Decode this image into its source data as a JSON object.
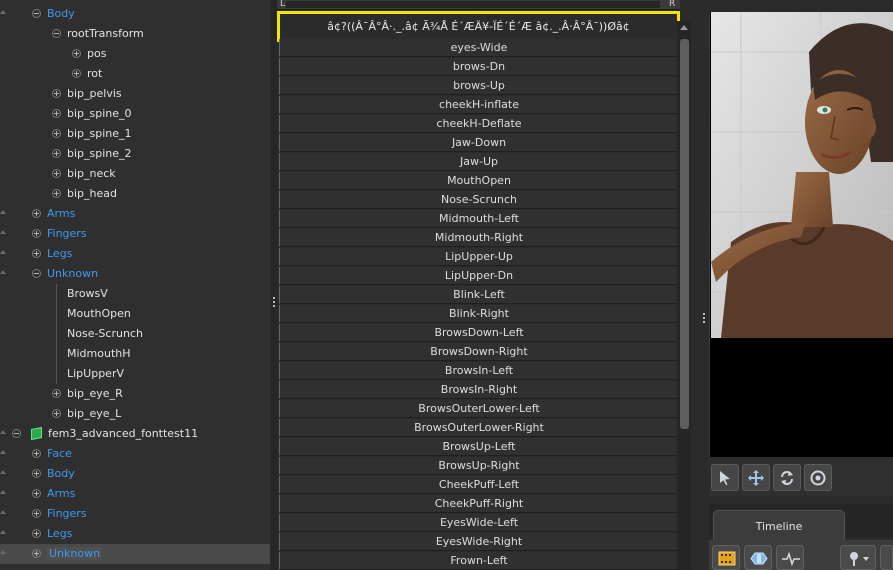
{
  "hierarchy": {
    "items": [
      {
        "label": "Body",
        "depth": 1,
        "toggle": "minus",
        "color": "blue"
      },
      {
        "label": "rootTransform",
        "depth": 2,
        "toggle": "minus",
        "color": "white"
      },
      {
        "label": "pos",
        "depth": 3,
        "toggle": "plus",
        "color": "white"
      },
      {
        "label": "rot",
        "depth": 3,
        "toggle": "plus",
        "color": "white"
      },
      {
        "label": "bip_pelvis",
        "depth": 2,
        "toggle": "plus",
        "color": "white"
      },
      {
        "label": "bip_spine_0",
        "depth": 2,
        "toggle": "plus",
        "color": "white"
      },
      {
        "label": "bip_spine_1",
        "depth": 2,
        "toggle": "plus",
        "color": "white"
      },
      {
        "label": "bip_spine_2",
        "depth": 2,
        "toggle": "plus",
        "color": "white"
      },
      {
        "label": "bip_neck",
        "depth": 2,
        "toggle": "plus",
        "color": "white"
      },
      {
        "label": "bip_head",
        "depth": 2,
        "toggle": "plus",
        "color": "white"
      },
      {
        "label": "Arms",
        "depth": 1,
        "toggle": "plus",
        "color": "blue"
      },
      {
        "label": "Fingers",
        "depth": 1,
        "toggle": "plus",
        "color": "blue"
      },
      {
        "label": "Legs",
        "depth": 1,
        "toggle": "plus",
        "color": "blue"
      },
      {
        "label": "Unknown",
        "depth": 1,
        "toggle": "minus",
        "color": "blue"
      },
      {
        "label": "BrowsV",
        "depth": 2,
        "toggle": "none",
        "color": "white"
      },
      {
        "label": "MouthOpen",
        "depth": 2,
        "toggle": "none",
        "color": "white"
      },
      {
        "label": "Nose-Scrunch",
        "depth": 2,
        "toggle": "none",
        "color": "white"
      },
      {
        "label": "MidmouthH",
        "depth": 2,
        "toggle": "none",
        "color": "white"
      },
      {
        "label": "LipUpperV",
        "depth": 2,
        "toggle": "none",
        "color": "white"
      },
      {
        "label": "bip_eye_R",
        "depth": 2,
        "toggle": "plus",
        "color": "white"
      },
      {
        "label": "bip_eye_L",
        "depth": 2,
        "toggle": "plus",
        "color": "white"
      },
      {
        "label": "fem3_advanced_fonttest11",
        "depth": 0,
        "toggle": "minus",
        "color": "white",
        "model": true
      },
      {
        "label": "Face",
        "depth": 1,
        "toggle": "plus",
        "color": "blue"
      },
      {
        "label": "Body",
        "depth": 1,
        "toggle": "plus",
        "color": "blue"
      },
      {
        "label": "Arms",
        "depth": 1,
        "toggle": "plus",
        "color": "blue"
      },
      {
        "label": "Fingers",
        "depth": 1,
        "toggle": "plus",
        "color": "blue"
      },
      {
        "label": "Legs",
        "depth": 1,
        "toggle": "plus",
        "color": "blue"
      },
      {
        "label": "Unknown",
        "depth": 1,
        "toggle": "plus",
        "color": "blue",
        "selected": true
      }
    ]
  },
  "flex_list": {
    "ruler_left": "L",
    "ruler_right": "R",
    "ruler_dots": "...",
    "highlighted_item": "â¢?((Â¯Â°Â·._.â¢ Ã¾Å É´ÆÄ¥-ÏÉ´É´Æ â¢._.Â·Â°Â¯))Øâ¢",
    "items": [
      "eyes-Wide",
      "brows-Dn",
      "brows-Up",
      "cheekH-inflate",
      "cheekH-Deflate",
      "Jaw-Down",
      "Jaw-Up",
      "MouthOpen",
      "Nose-Scrunch",
      "Midmouth-Left",
      "Midmouth-Right",
      "LipUpper-Up",
      "LipUpper-Dn",
      "Blink-Left",
      "Blink-Right",
      "BrowsDown-Left",
      "BrowsDown-Right",
      "BrowsIn-Left",
      "BrowsIn-Right",
      "BrowsOuterLower-Left",
      "BrowsOuterLower-Right",
      "BrowsUp-Left",
      "BrowsUp-Right",
      "CheekPuff-Left",
      "CheekPuff-Right",
      "EyesWide-Left",
      "EyesWide-Right",
      "Frown-Left"
    ]
  },
  "viewport": {
    "background": "#000000"
  },
  "tabs": {
    "timeline": "Timeline"
  },
  "colors": {
    "accent_blue": "#3e9af0",
    "highlight_yellow": "#f1e600",
    "model_icon_green": "#2da84a"
  }
}
